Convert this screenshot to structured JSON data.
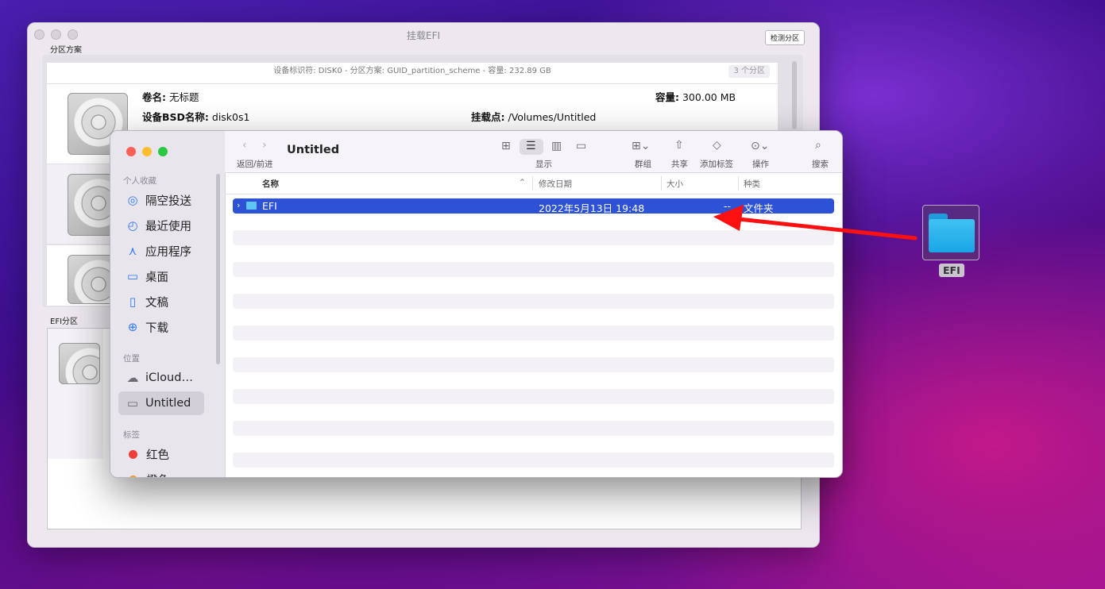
{
  "efi_window": {
    "title": "挂载EFI",
    "detect_button": "检测分区",
    "partition_scheme_label": "分区方案",
    "efi_partition_label": "EFI分区",
    "header_info": "设备标识符: DISK0 - 分区方案: GUID_partition_scheme - 容量: 232.89 GB",
    "partition_count": "3 个分区",
    "volume_label": "卷名:",
    "volume_name": "无标题",
    "capacity_label": "容量:",
    "capacity_value": "300.00 MB",
    "bsd_label": "设备BSD名称:",
    "bsd_value": "disk0s1",
    "mount_label": "挂载点:",
    "mount_value": "/Volumes/Untitled"
  },
  "finder": {
    "window_title": "Untitled",
    "toolbar": {
      "back_forward": "返回/前进",
      "view": "显示",
      "group": "群组",
      "share": "共享",
      "add_tag": "添加标签",
      "action": "操作",
      "search": "搜索"
    },
    "sidebar": {
      "favorites_header": "个人收藏",
      "favorites": [
        {
          "label": "隔空投送",
          "icon": "airdrop-icon"
        },
        {
          "label": "最近使用",
          "icon": "clock-icon"
        },
        {
          "label": "应用程序",
          "icon": "applications-icon"
        },
        {
          "label": "桌面",
          "icon": "desktop-icon"
        },
        {
          "label": "文稿",
          "icon": "document-icon"
        },
        {
          "label": "下载",
          "icon": "download-icon"
        }
      ],
      "locations_header": "位置",
      "locations": [
        {
          "label": "iCloud…",
          "icon": "cloud-icon"
        },
        {
          "label": "Untitled",
          "icon": "drive-icon"
        }
      ],
      "tags_header": "标签",
      "tags": [
        {
          "label": "红色",
          "color": "#f0403c"
        },
        {
          "label": "橙色",
          "color": "#f59a2b"
        }
      ]
    },
    "columns": {
      "name": "名称",
      "modified": "修改日期",
      "size": "大小",
      "kind": "种类"
    },
    "rows": [
      {
        "name": "EFI",
        "modified": "2022年5月13日 19:48",
        "size": "--",
        "kind": "文件夹"
      }
    ]
  },
  "desktop": {
    "icon_label": "EFI"
  }
}
